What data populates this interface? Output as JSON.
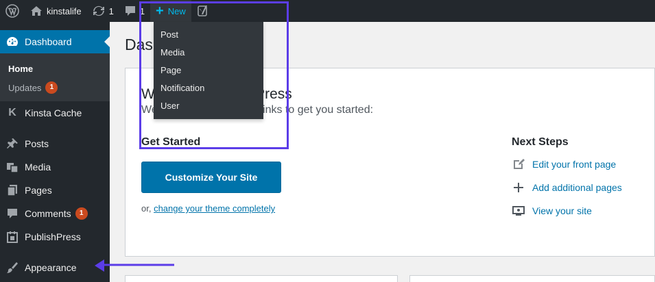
{
  "adminbar": {
    "site_name": "kinstalife",
    "updates_count": "1",
    "comments_count": "1",
    "new_label": "New",
    "new_menu": [
      "Post",
      "Media",
      "Page",
      "Notification",
      "User"
    ]
  },
  "sidebar": {
    "dashboard": "Dashboard",
    "submenu": {
      "home": "Home",
      "updates": "Updates",
      "updates_badge": "1"
    },
    "items": [
      {
        "label": "Kinsta Cache",
        "icon": "kinsta-k-icon"
      },
      {
        "label": "Posts",
        "icon": "pin-icon"
      },
      {
        "label": "Media",
        "icon": "media-icon"
      },
      {
        "label": "Pages",
        "icon": "pages-icon"
      },
      {
        "label": "Comments",
        "icon": "comment-icon",
        "badge": "1"
      },
      {
        "label": "PublishPress",
        "icon": "calendar-icon"
      },
      {
        "label": "Appearance",
        "icon": "brush-icon"
      }
    ]
  },
  "main": {
    "page_title": "Dashboard",
    "welcome_title": "Welcome to WordPress",
    "welcome_sub": "We've assembled some links to get you started:",
    "get_started": "Get Started",
    "customize_button": "Customize Your Site",
    "or_prefix": "or, ",
    "change_theme_link": "change your theme completely",
    "next_steps": "Next Steps",
    "steps": [
      "Edit your front page",
      "Add additional pages",
      "View your site"
    ]
  },
  "colors": {
    "adminbar_bg": "#23282d",
    "accent": "#0073aa",
    "new_label": "#00b9eb",
    "badge": "#ca4a1f",
    "annotation": "#5b3de8"
  }
}
